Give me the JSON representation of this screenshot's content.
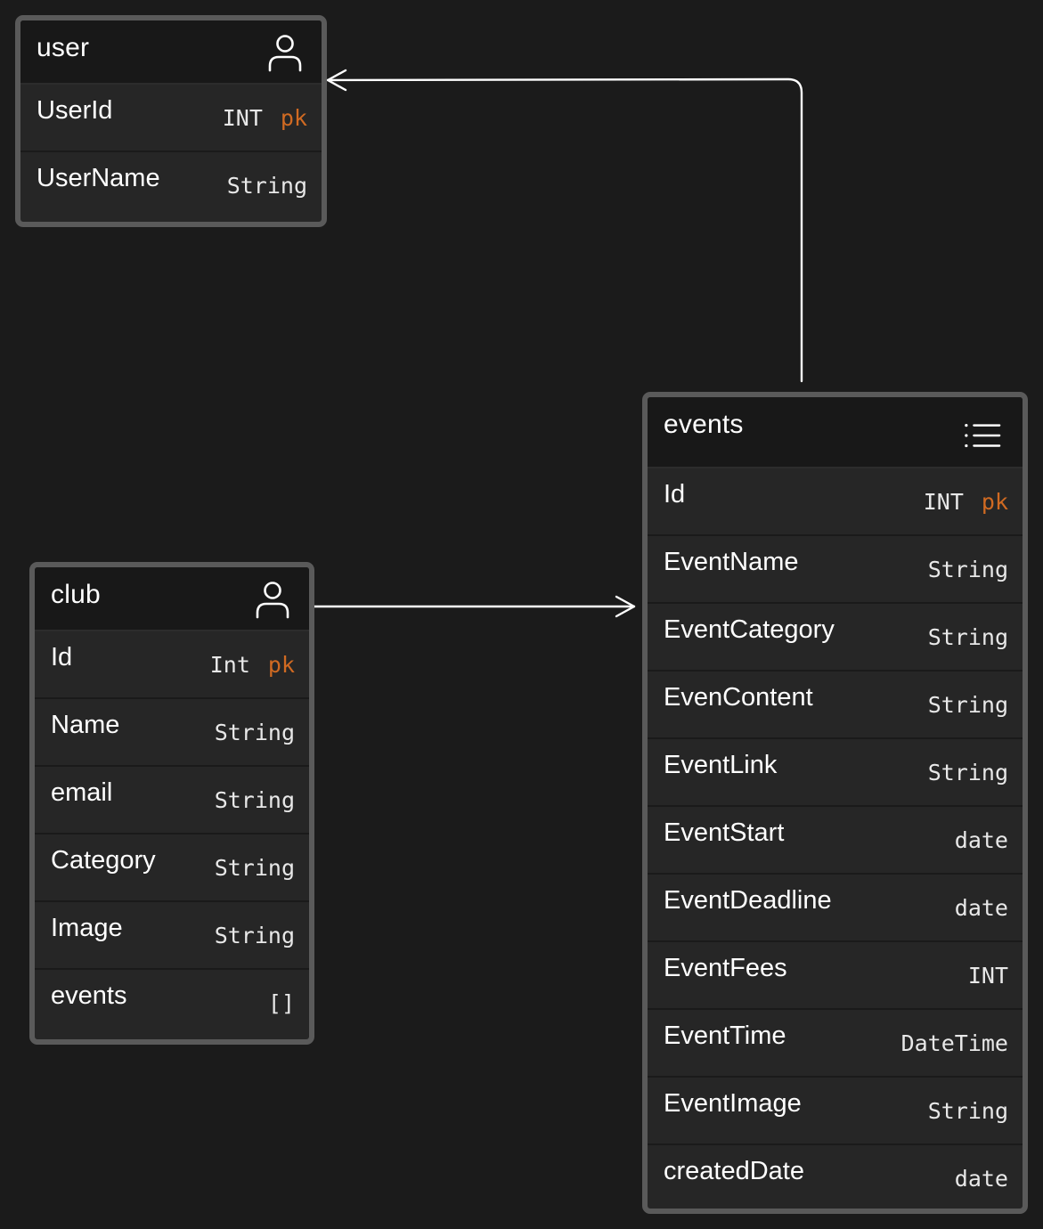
{
  "colors": {
    "background": "#1b1b1b",
    "table_border": "#5a5a5a",
    "header_bg": "#181818",
    "row_bg": "#262626",
    "key_accent": "#d06a22",
    "connector": "#ffffff"
  },
  "tables": {
    "user": {
      "title": "user",
      "icon": "user-icon",
      "fields": [
        {
          "name": "UserId",
          "type": "INT",
          "key": "pk"
        },
        {
          "name": "UserName",
          "type": "String",
          "key": ""
        }
      ]
    },
    "club": {
      "title": "club",
      "icon": "user-icon",
      "fields": [
        {
          "name": "Id",
          "type": "Int",
          "key": "pk"
        },
        {
          "name": "Name",
          "type": "String",
          "key": ""
        },
        {
          "name": "email",
          "type": "String",
          "key": ""
        },
        {
          "name": "Category",
          "type": "String",
          "key": ""
        },
        {
          "name": "Image",
          "type": "String",
          "key": ""
        },
        {
          "name": "events",
          "type": "[]",
          "key": ""
        }
      ]
    },
    "events": {
      "title": "events",
      "icon": "list-icon",
      "fields": [
        {
          "name": "Id",
          "type": "INT",
          "key": "pk"
        },
        {
          "name": "EventName",
          "type": "String",
          "key": ""
        },
        {
          "name": "EventCategory",
          "type": "String",
          "key": ""
        },
        {
          "name": "EvenContent",
          "type": "String",
          "key": ""
        },
        {
          "name": "EventLink",
          "type": "String",
          "key": ""
        },
        {
          "name": "EventStart",
          "type": "date",
          "key": ""
        },
        {
          "name": "EventDeadline",
          "type": "date",
          "key": ""
        },
        {
          "name": "EventFees",
          "type": "INT",
          "key": ""
        },
        {
          "name": "EventTime",
          "type": "DateTime",
          "key": ""
        },
        {
          "name": "EventImage",
          "type": "String",
          "key": ""
        },
        {
          "name": "createdDate",
          "type": "date",
          "key": ""
        }
      ]
    }
  },
  "relations": [
    {
      "from": "events",
      "to": "user"
    },
    {
      "from": "club",
      "to": "events"
    }
  ]
}
